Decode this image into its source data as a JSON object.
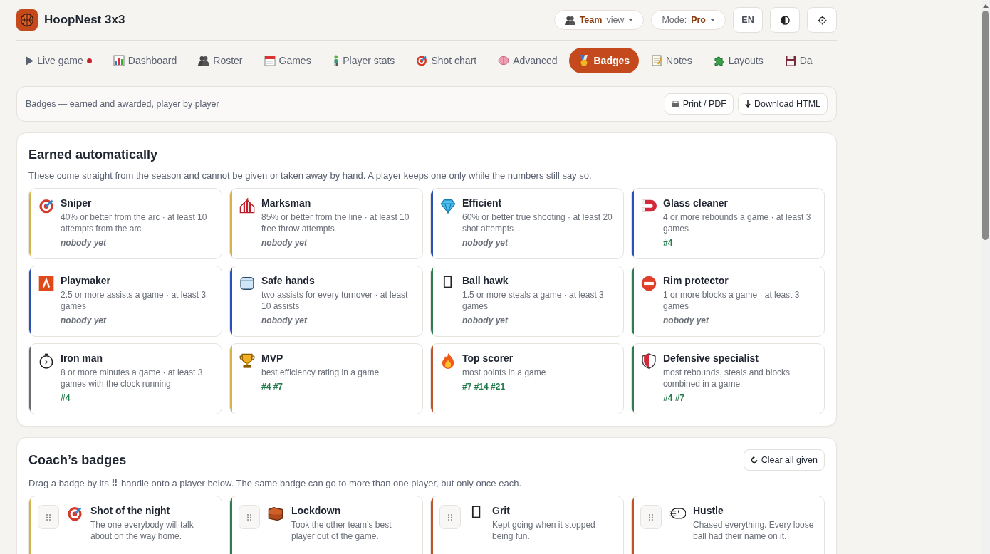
{
  "app": {
    "title": "HoopNest 3x3"
  },
  "header_controls": {
    "view": {
      "strong": "Team",
      "rest": "view"
    },
    "mode": {
      "label": "Mode:",
      "value": "Pro"
    },
    "language": "EN"
  },
  "tabs": [
    {
      "label": "Live game",
      "selected": false,
      "live": true
    },
    {
      "label": "Dashboard",
      "selected": false,
      "live": false
    },
    {
      "label": "Roster",
      "selected": false,
      "live": false
    },
    {
      "label": "Games",
      "selected": false,
      "live": false
    },
    {
      "label": "Player stats",
      "selected": false,
      "live": false
    },
    {
      "label": "Shot chart",
      "selected": false,
      "live": false
    },
    {
      "label": "Advanced",
      "selected": false,
      "live": false
    },
    {
      "label": "Badges",
      "selected": true,
      "live": false
    },
    {
      "label": "Notes",
      "selected": false,
      "live": false
    },
    {
      "label": "Layouts",
      "selected": false,
      "live": false
    },
    {
      "label": "Da",
      "selected": false,
      "live": false
    }
  ],
  "subheader": {
    "text": "Badges — earned and awarded, player by player",
    "buttons": [
      "Print / PDF",
      "Download HTML"
    ]
  },
  "earned": {
    "title": "Earned automatically",
    "description": "These come straight from the season and cannot be given or taken away by hand. A player keeps one only while the numbers still say so.",
    "badges": [
      {
        "name": "Sniper",
        "rule": "40% or better from the arc · at least 10 attempts from the arc",
        "holders": "nobody yet",
        "awarded": false,
        "color": "#d4b44a"
      },
      {
        "name": "Marksman",
        "rule": "85% or better from the line · at least 10 free throw attempts",
        "holders": "nobody yet",
        "awarded": false,
        "color": "#d4b44a"
      },
      {
        "name": "Efficient",
        "rule": "60% or better true shooting · at least 20 shot attempts",
        "holders": "nobody yet",
        "awarded": false,
        "color": "#2d4fb8"
      },
      {
        "name": "Glass cleaner",
        "rule": "4 or more rebounds a game · at least 3 games",
        "holders": "#4",
        "awarded": true,
        "color": "#2d4fb8"
      },
      {
        "name": "Playmaker",
        "rule": "2.5 or more assists a game · at least 3 games",
        "holders": "nobody yet",
        "awarded": false,
        "color": "#2d4fb8"
      },
      {
        "name": "Safe hands",
        "rule": "two assists for every turnover · at least 10 assists",
        "holders": "nobody yet",
        "awarded": false,
        "color": "#2d4fb8"
      },
      {
        "name": "Ball hawk",
        "rule": "1.5 or more steals a game · at least 3 games",
        "holders": "nobody yet",
        "awarded": false,
        "color": "#2e7d4f"
      },
      {
        "name": "Rim protector",
        "rule": "1 or more blocks a game · at least 3 games",
        "holders": "nobody yet",
        "awarded": false,
        "color": "#2e7d4f"
      },
      {
        "name": "Iron man",
        "rule": "8 or more minutes a game · at least 3 games with the clock running",
        "holders": "#4",
        "awarded": true,
        "color": "#6b6b73"
      },
      {
        "name": "MVP",
        "rule": "best efficiency rating in a game",
        "holders": "#4 #7",
        "awarded": true,
        "color": "#d4b44a"
      },
      {
        "name": "Top scorer",
        "rule": "most points in a game",
        "holders": "#7 #14 #21",
        "awarded": true,
        "color": "#c0532a"
      },
      {
        "name": "Defensive specialist",
        "rule": "most rebounds, steals and blocks combined in a game",
        "holders": "#4 #7",
        "awarded": true,
        "color": "#2e7d4f"
      }
    ]
  },
  "coach": {
    "title": "Coach’s badges",
    "clear_button": "Clear all given",
    "instructions": "Drag a badge by its ⠿ handle onto a player below. The same badge can go to more than one player, but only once each.",
    "badges": [
      {
        "name": "Shot of the night",
        "description": "The one everybody will talk about on the way home.",
        "color": "#d4b44a"
      },
      {
        "name": "Lockdown",
        "description": "Took the other team’s best player out of the game.",
        "color": "#2e7d4f"
      },
      {
        "name": "Grit",
        "description": "Kept going when it stopped being fun.",
        "color": "#c0532a"
      },
      {
        "name": "Hustle",
        "description": "Chased everything. Every loose ball had their name on it.",
        "color": "#c0532a"
      }
    ]
  }
}
